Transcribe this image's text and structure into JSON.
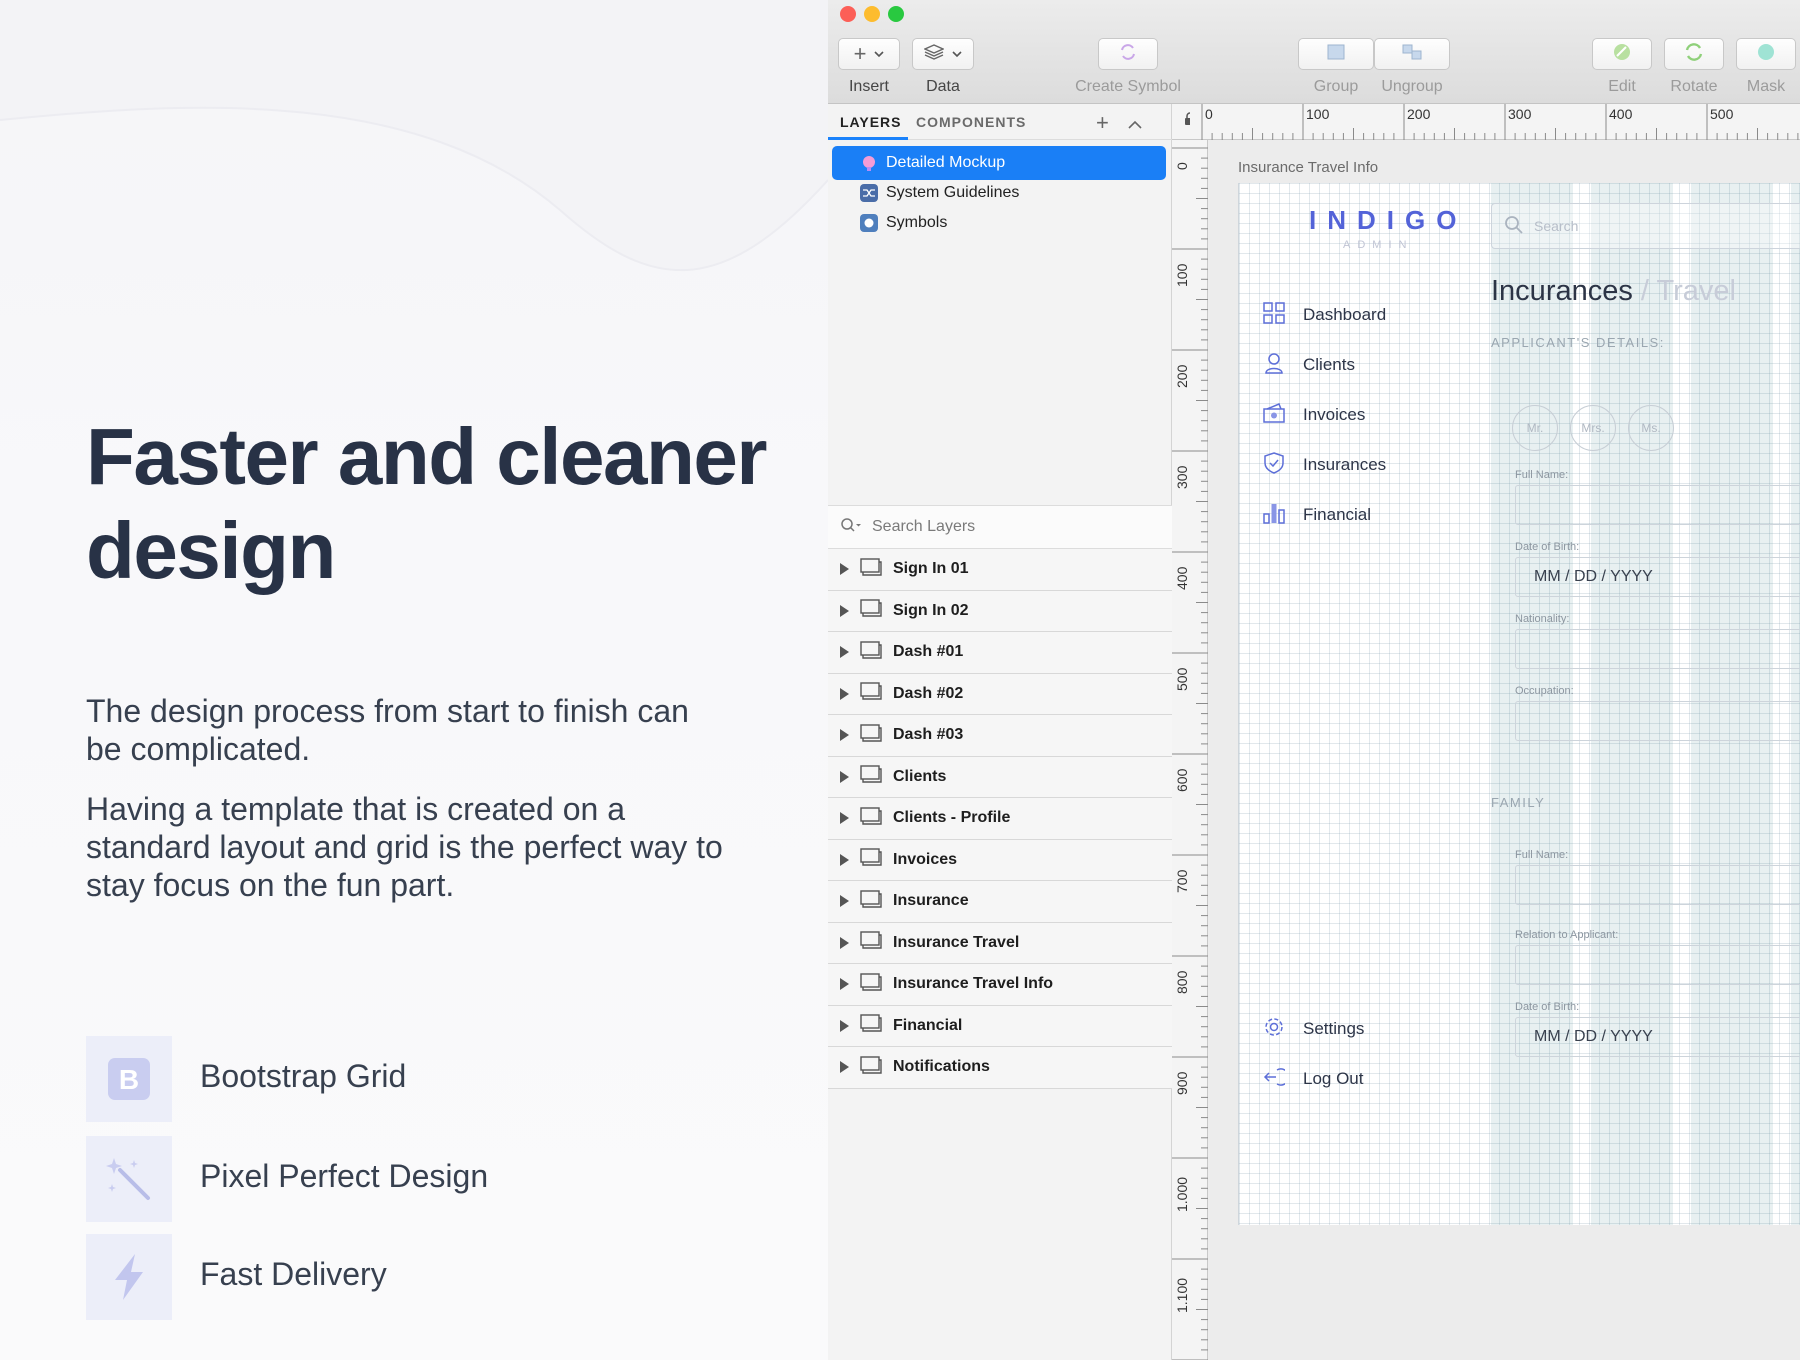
{
  "marketing": {
    "headline": "Faster and cleaner design",
    "para1": "The design process from start to finish can be complicated.",
    "para2": "Having a template that is created on a standard layout and grid is the perfect way to stay focus on the fun part.",
    "features": [
      {
        "label": "Bootstrap Grid",
        "icon": "bootstrap-icon"
      },
      {
        "label": "Pixel Perfect Design",
        "icon": "magic-wand-icon"
      },
      {
        "label": "Fast Delivery",
        "icon": "lightning-icon"
      }
    ]
  },
  "toolbar": {
    "insert_label": "Insert",
    "data_label": "Data",
    "create_symbol_label": "Create Symbol",
    "group_label": "Group",
    "ungroup_label": "Ungroup",
    "edit_label": "Edit",
    "rotate_label": "Rotate",
    "mask_label": "Mask"
  },
  "sidebar": {
    "tab_layers": "LAYERS",
    "tab_components": "COMPONENTS",
    "pages": [
      {
        "label": "Detailed Mockup",
        "active": true
      },
      {
        "label": "System Guidelines",
        "active": false
      },
      {
        "label": "Symbols",
        "active": false
      }
    ],
    "search_placeholder": "Search Layers",
    "artboards": [
      "Sign In 01",
      "Sign In 02",
      "Dash #01",
      "Dash #02",
      "Dash #03",
      "Clients",
      "Clients - Profile",
      "Invoices",
      "Insurance",
      "Insurance Travel",
      "Insurance Travel Info",
      "Financial",
      "Notifications"
    ]
  },
  "rulers": {
    "top": [
      "0",
      "100",
      "200",
      "300",
      "400",
      "500"
    ],
    "left": [
      "0",
      "100",
      "200",
      "300",
      "400",
      "500",
      "600",
      "700",
      "800",
      "900",
      "1.000",
      "1.100"
    ]
  },
  "canvas": {
    "artboard_title": "Insurance Travel Info",
    "logo": "INDIGO",
    "logo_sub": "ADMIN",
    "search_placeholder": "Search",
    "nav": [
      "Dashboard",
      "Clients",
      "Invoices",
      "Insurances",
      "Financial"
    ],
    "nav_active": "Insurances",
    "nav_bottom": [
      "Settings",
      "Log Out"
    ],
    "heading_main": "Incurances",
    "heading_sub": " / Travel",
    "applicant_label": "APPLICANT'S DETAILS:",
    "titles": [
      "Mr.",
      "Mrs.",
      "Ms."
    ],
    "fields": {
      "full_name": "Full Name:",
      "dob": "Date of Birth:",
      "dob_value": "MM / DD / YYYY",
      "nationality": "Nationality:",
      "occupation": "Occupation:",
      "family": "FAMILY",
      "family_full_name": "Full Name:",
      "relation": "Relation to Applicant:",
      "family_dob": "Date of Birth:",
      "family_dob_value": "MM / DD / YYYY"
    }
  },
  "colors": {
    "accent": "#1a7ff6",
    "brand": "#5363d8",
    "feature_bg": "#eceef9"
  }
}
